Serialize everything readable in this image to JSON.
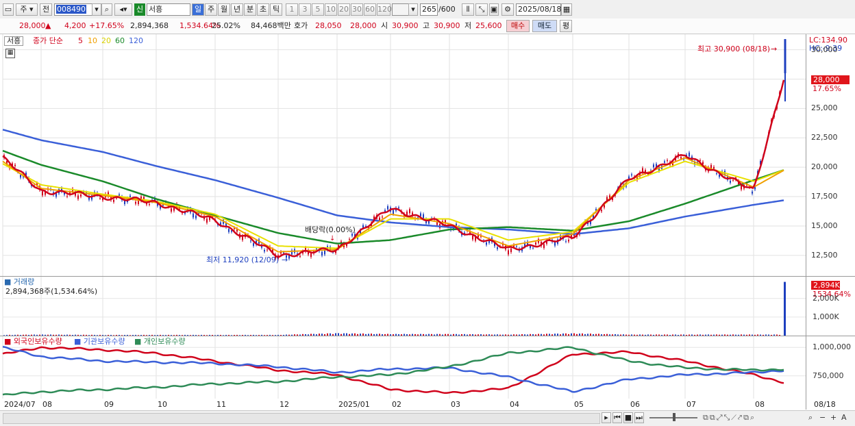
{
  "toolbar": {
    "market": "주",
    "prev": "전",
    "code": "008490",
    "sin": "신",
    "stock_name": "서흥",
    "periods": [
      "일",
      "주",
      "월",
      "년",
      "분",
      "초",
      "틱"
    ],
    "intervals": [
      "1",
      "3",
      "5",
      "10",
      "20",
      "30",
      "60",
      "120"
    ],
    "count": "265",
    "count_total": "/600",
    "date": "2025/08/18"
  },
  "quote": {
    "price": "28,000",
    "change_arrow": "▲",
    "change": "4,200",
    "change_pct": "+17.65%",
    "volume": "2,894,368",
    "volume_pct": "1,534.64%",
    "turnover_pct": "25.02%",
    "trade_value": "84,468백만",
    "bid_label": "호가",
    "bid": "28,050",
    "ask": "28,000",
    "open_label": "시",
    "open": "30,900",
    "high_label": "고",
    "high": "30,900",
    "low_label": "저",
    "low": "25,600",
    "buy_label": "매수",
    "sell_label": "매도",
    "avg_label": "평"
  },
  "price_panel": {
    "name_tab": "서흥",
    "legend_prefix": "종가 단순",
    "ma_labels": [
      "5",
      "10",
      "20",
      "60",
      "120"
    ],
    "ma_colors": [
      "#d0021b",
      "#f0a000",
      "#e8e000",
      "#1a8a2a",
      "#3a5fd8"
    ],
    "lc": "LC:134.90",
    "hc": "HC:-9.39",
    "current_tag": "28,000",
    "current_pct": "17.65%",
    "high_note": "최고 30,900 (08/18)",
    "low_note": "최저 11,920 (12/09)",
    "event_note": "배당락(0.00%)",
    "y_ticks": [
      "30,000",
      "27,500",
      "25,000",
      "22,500",
      "20,000",
      "17,500",
      "15,000",
      "12,500"
    ]
  },
  "volume_panel": {
    "title": "거래량",
    "value_text": "2,894,368주(1,534.64%)",
    "tag": "2,894K",
    "tag_pct": "1534.64%",
    "y_ticks": [
      "2,000K",
      "1,000K"
    ]
  },
  "holding_panel": {
    "legend": [
      "외국인보유수량",
      "기관보유수량",
      "개인보유수량"
    ],
    "colors": [
      "#d0021b",
      "#3a5fd8",
      "#2e8b57"
    ],
    "y_ticks": [
      "1,000,000",
      "750,000"
    ]
  },
  "x_axis": [
    "2024/07",
    "08",
    "09",
    "10",
    "11",
    "12",
    "2025/01",
    "02",
    "03",
    "04",
    "05",
    "06",
    "07",
    "08"
  ],
  "x_axis_right": "08/18",
  "chart_data": [
    {
      "type": "line",
      "title": "서흥 종가 단순 5 10 20 60 120",
      "x": [
        "2024/07",
        "08",
        "09",
        "10",
        "11",
        "12",
        "2025/01",
        "02",
        "03",
        "04",
        "05",
        "06",
        "07",
        "08",
        "08/18"
      ],
      "ylim": [
        10800,
        31200
      ],
      "series": [
        {
          "name": "5",
          "values": [
            20800,
            18000,
            17500,
            17000,
            15500,
            12500,
            13000,
            16500,
            15000,
            13000,
            14000,
            19000,
            21000,
            18000,
            28000
          ]
        },
        {
          "name": "10",
          "values": [
            20500,
            18200,
            17600,
            17000,
            15800,
            12800,
            13000,
            16000,
            15200,
            13300,
            14300,
            18900,
            20800,
            18300,
            19800
          ]
        },
        {
          "name": "20",
          "values": [
            20300,
            18500,
            17700,
            17100,
            16000,
            13300,
            13100,
            15600,
            15600,
            13800,
            14500,
            18700,
            20500,
            18800,
            19800
          ]
        },
        {
          "name": "60",
          "values": [
            21400,
            20200,
            18800,
            17300,
            15900,
            14400,
            13500,
            13800,
            14700,
            14900,
            14600,
            15400,
            16900,
            18900,
            19800
          ]
        },
        {
          "name": "120",
          "values": [
            23200,
            22300,
            21300,
            20100,
            18900,
            17400,
            15900,
            15300,
            14900,
            14700,
            14300,
            14800,
            15800,
            16800,
            17200
          ]
        }
      ]
    },
    {
      "type": "bar",
      "title": "거래량",
      "categories": [
        "2024/07",
        "08",
        "09",
        "10",
        "11",
        "12",
        "2025/01",
        "02",
        "03",
        "04",
        "05",
        "06",
        "07",
        "08",
        "08/18"
      ],
      "values": [
        40,
        60,
        40,
        40,
        40,
        40,
        140,
        90,
        90,
        60,
        130,
        60,
        60,
        60,
        2894
      ],
      "ylim": [
        0,
        3100
      ]
    },
    {
      "type": "line",
      "title": "보유수량",
      "x": [
        "2024/07",
        "08",
        "09",
        "10",
        "11",
        "12",
        "2025/01",
        "02",
        "03",
        "04",
        "05",
        "06",
        "07",
        "08",
        "08/18"
      ],
      "ylim": [
        550000,
        1080000
      ],
      "series": [
        {
          "name": "외국인보유수량",
          "values": [
            940000,
            1000000,
            980000,
            950000,
            880000,
            800000,
            760000,
            630000,
            600000,
            640000,
            940000,
            960000,
            880000,
            760000,
            690000
          ]
        },
        {
          "name": "기관보유수량",
          "values": [
            1000000,
            920000,
            880000,
            870000,
            860000,
            830000,
            780000,
            810000,
            820000,
            740000,
            610000,
            720000,
            760000,
            780000,
            800000
          ]
        },
        {
          "name": "개인보유수량",
          "values": [
            580000,
            610000,
            630000,
            650000,
            680000,
            700000,
            740000,
            760000,
            830000,
            950000,
            1000000,
            880000,
            820000,
            800000,
            810000
          ]
        }
      ]
    }
  ]
}
